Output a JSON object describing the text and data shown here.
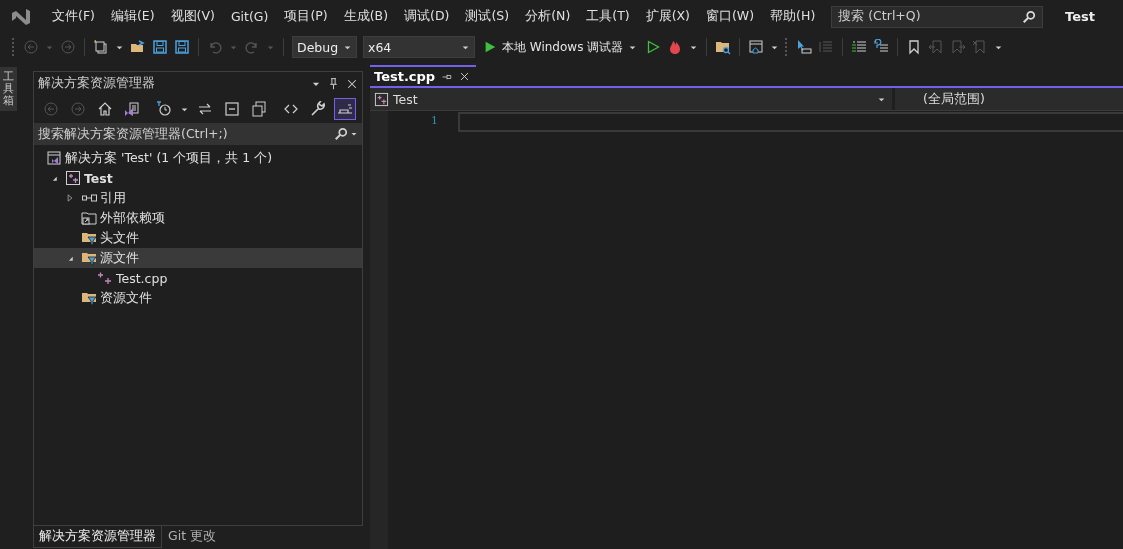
{
  "menu": {
    "items": [
      "文件(F)",
      "编辑(E)",
      "视图(V)",
      "Git(G)",
      "项目(P)",
      "生成(B)",
      "调试(D)",
      "测试(S)",
      "分析(N)",
      "工具(T)",
      "扩展(X)",
      "窗口(W)",
      "帮助(H)"
    ],
    "search": {
      "placeholder": "搜索 (Ctrl+Q)"
    },
    "solution_name": "Test"
  },
  "toolbar": {
    "left_buttons": [
      {
        "disabled": true
      },
      {
        "disabled": true
      },
      {
        "disabled": false
      },
      {
        "disabled": false
      },
      {
        "disabled": false
      },
      {
        "disabled": false
      },
      {
        "disabled": true
      },
      {
        "disabled": true
      }
    ],
    "configuration": "Debug",
    "platform": "x64",
    "run_label": "本地 Windows 调试器",
    "right_buttons": [
      {
        "disabled": false
      },
      {
        "disabled": false
      },
      {
        "disabled": false
      },
      {
        "disabled": false
      },
      {
        "disabled": false
      },
      {
        "disabled": true
      },
      {
        "disabled": false
      },
      {
        "disabled": false
      },
      {
        "disabled": false
      },
      {
        "disabled": true
      },
      {
        "disabled": true
      },
      {
        "disabled": true
      }
    ]
  },
  "toolbox_tab": "工具箱",
  "explorer": {
    "title": "解决方案资源管理器",
    "tools": [
      {
        "disabled": true,
        "pressed": false
      },
      {
        "disabled": true,
        "pressed": false
      },
      {
        "disabled": false,
        "pressed": false
      },
      {
        "disabled": false,
        "pressed": false
      },
      {
        "disabled": false,
        "pressed": false
      },
      {
        "disabled": false,
        "pressed": false
      },
      {
        "disabled": false,
        "pressed": false
      },
      {
        "disabled": false,
        "pressed": false
      },
      {
        "disabled": false,
        "pressed": false
      },
      {
        "disabled": false,
        "pressed": false
      },
      {
        "disabled": false,
        "pressed": true
      }
    ],
    "search": {
      "placeholder": "搜索解决方案资源管理器(Ctrl+;)"
    },
    "tree": [
      {
        "kind": "solution",
        "label": "解决方案 'Test' (1 个项目，共 1 个)",
        "selected": false,
        "children": [
          {
            "kind": "project",
            "label": "Test",
            "expanded": true,
            "selected": false,
            "children": [
              {
                "kind": "references",
                "label": "引用",
                "expanded": false,
                "selected": false
              },
              {
                "kind": "external",
                "label": "外部依赖项",
                "selected": false
              },
              {
                "kind": "filter",
                "label": "头文件",
                "selected": false
              },
              {
                "kind": "filter",
                "label": "源文件",
                "expanded": true,
                "selected": true,
                "children": [
                  {
                    "kind": "cpp",
                    "label": "Test.cpp",
                    "selected": false
                  }
                ]
              },
              {
                "kind": "filter",
                "label": "资源文件",
                "selected": false
              }
            ]
          }
        ]
      }
    ],
    "bottom_tabs": [
      {
        "label": "解决方案资源管理器",
        "selected": true
      },
      {
        "label": "Git 更改",
        "selected": false
      }
    ]
  },
  "editor": {
    "tabs": [
      {
        "label": "Test.cpp",
        "selected": true
      }
    ],
    "project": "Test",
    "scope": "(全局范围)",
    "line_numbers": [
      "1"
    ]
  }
}
